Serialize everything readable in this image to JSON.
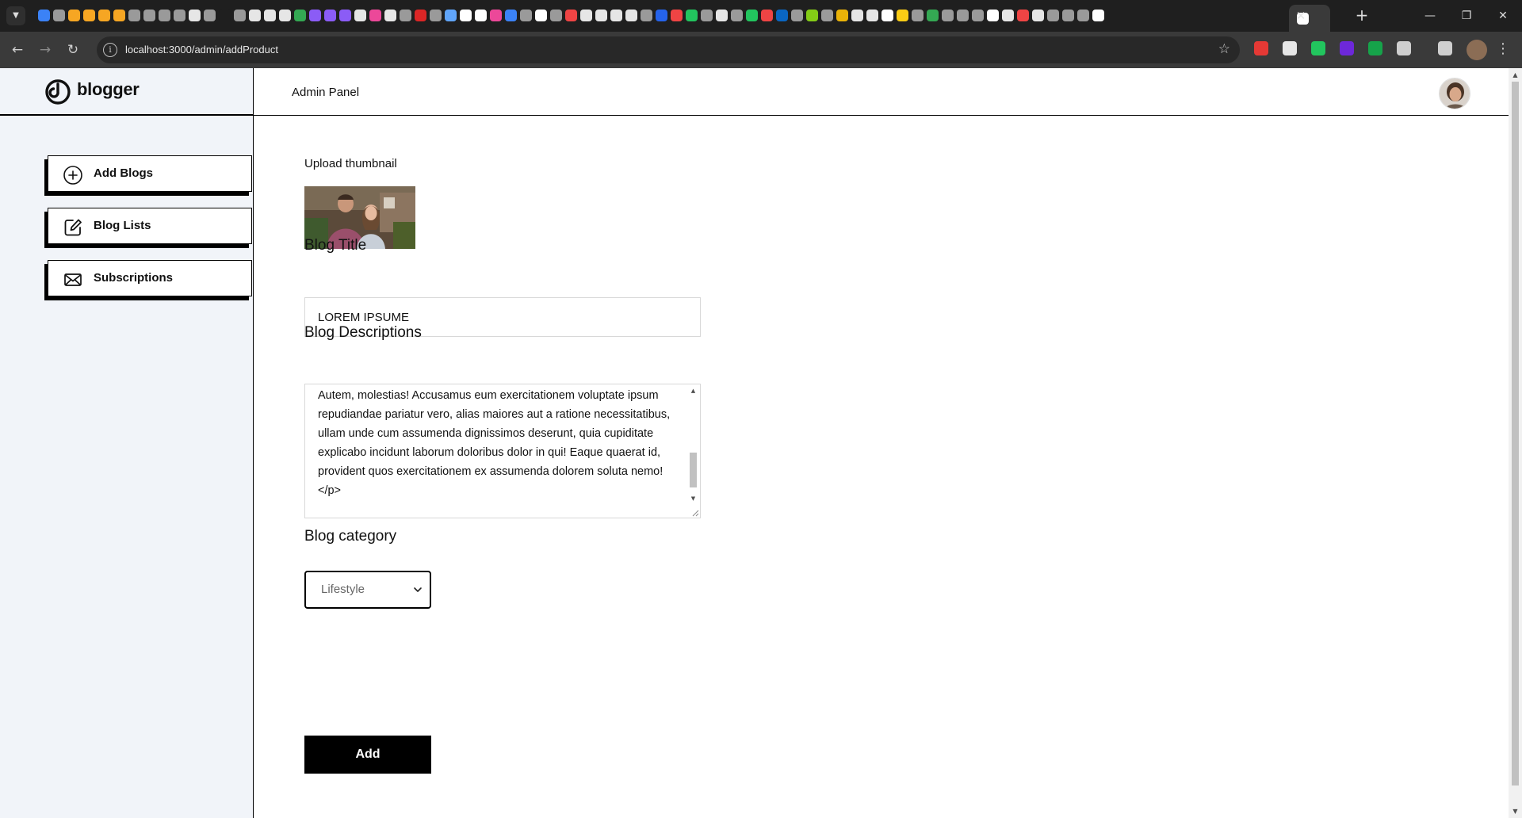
{
  "browser": {
    "url": "localhost:3000/admin/addProduct",
    "tab_close": "✕",
    "new_tab": "+",
    "favicon_colors": [
      "#3b82f6",
      "#9a9a9a",
      "#f6a623",
      "#f6a623",
      "#f6a623",
      "#f6a623",
      "#9a9a9a",
      "#9a9a9a",
      "#9a9a9a",
      "#9a9a9a",
      "#e6e6e6",
      "#9a9a9a",
      "#1f1f1f",
      "#9a9a9a",
      "#e6e6e6",
      "#e6e6e6",
      "#e6e6e6",
      "#34a853",
      "#8b5cf6",
      "#8b5cf6",
      "#8b5cf6",
      "#e6e6e6",
      "#ec4899",
      "#e6e6e6",
      "#9a9a9a",
      "#dc2626",
      "#9a9a9a",
      "#60a5fa",
      "#ffffff",
      "#ffffff",
      "#ec4899",
      "#3b82f6",
      "#9a9a9a",
      "#ffffff",
      "#9a9a9a",
      "#ef4444",
      "#e6e6e6",
      "#e6e6e6",
      "#e6e6e6",
      "#e6e6e6",
      "#9a9a9a",
      "#2563eb",
      "#ef4444",
      "#22c55e",
      "#9a9a9a",
      "#e6e6e6",
      "#9a9a9a",
      "#22c55e",
      "#ef4444",
      "#0a66c2",
      "#9a9a9a",
      "#84cc16",
      "#9a9a9a",
      "#eab308",
      "#e6e6e6",
      "#e6e6e6",
      "#ffffff",
      "#facc15",
      "#9a9a9a",
      "#34a853",
      "#9a9a9a",
      "#9a9a9a",
      "#9a9a9a",
      "#ffffff",
      "#e6e6e6",
      "#ef4444",
      "#e6e6e6",
      "#9a9a9a",
      "#9a9a9a",
      "#9a9a9a",
      "#ffffff"
    ],
    "extension_colors": [
      "#e53935",
      "#e6e6e6",
      "#22c55e",
      "#6d28d9",
      "#16a34a",
      "#cfcfcf",
      "#cfcfcf"
    ]
  },
  "brand": {
    "name": "blogger"
  },
  "header": {
    "title": "Admin Panel"
  },
  "sidebar": {
    "items": [
      {
        "label": "Add Blogs",
        "icon": "plus-circle-icon"
      },
      {
        "label": "Blog Lists",
        "icon": "edit-icon"
      },
      {
        "label": "Subscriptions",
        "icon": "mail-icon"
      }
    ]
  },
  "form": {
    "thumbnail_label": "Upload thumbnail",
    "title_label": "Blog Title",
    "title_value": "LOREM IPSUME",
    "description_label": "Blog Descriptions",
    "description_value": "Autem, molestias! Accusamus eum exercitationem voluptate ipsum repudiandae pariatur vero, alias maiores aut a ratione necessitatibus, ullam unde cum assumenda dignissimos deserunt, quia cupiditate explicabo incidunt laborum doloribus dolor in qui! Eaque quaerat id, provident quos exercitationem ex assumenda dolorem soluta nemo!</p>",
    "category_label": "Blog category",
    "category_value": "Lifestyle",
    "submit_label": "Add"
  },
  "colors": {
    "sidebar_bg": "#f1f4f9",
    "button_bg": "#000000",
    "chrome_dark": "#1f1f1f",
    "chrome_toolbar": "#3a3a3a"
  }
}
